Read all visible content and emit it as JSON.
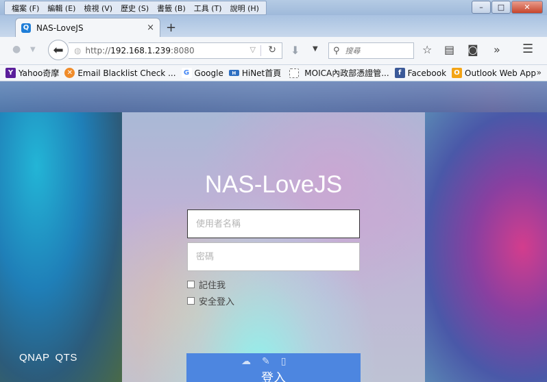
{
  "window": {
    "menu": [
      "檔案 (F)",
      "編輯 (E)",
      "檢視 (V)",
      "歷史 (S)",
      "書籤 (B)",
      "工具 (T)",
      "說明 (H)"
    ],
    "controls": {
      "minimize": "–",
      "maximize": "□",
      "close": "✕"
    }
  },
  "tab": {
    "favicon": "Q",
    "title": "NAS-LoveJS",
    "close": "×",
    "new_tab": "+"
  },
  "navbar": {
    "url_scheme": "http://",
    "url_host": "192.168.1.239",
    "url_port": ":8080",
    "search_placeholder": "搜尋"
  },
  "bookmarks": {
    "items": [
      {
        "label": "Yahoo奇摩",
        "icon": "Y",
        "color": "#5b1f9b"
      },
      {
        "label": "Email Blacklist Check ...",
        "icon": "✕",
        "color": "#f08c2a"
      },
      {
        "label": "Google",
        "icon": "G",
        "color": "#ffffff"
      },
      {
        "label": "HiNet首頁",
        "icon": "H",
        "color": "#2e6fc1"
      },
      {
        "label": "MOICA內政部憑證管...",
        "icon": "",
        "color": "#ffffff"
      },
      {
        "label": "Facebook",
        "icon": "f",
        "color": "#3b5998"
      },
      {
        "label": "Outlook Web App",
        "icon": "O",
        "color": "#f3a416"
      }
    ],
    "more": "»"
  },
  "login": {
    "title": "NAS-LoveJS",
    "username_placeholder": "使用者名稱",
    "password_placeholder": "密碼",
    "remember_me": "記住我",
    "secure_login": "安全登入",
    "submit": "登入"
  },
  "footer": {
    "brand": "QNAP",
    "product": "QTS"
  },
  "colors": {
    "login_button": "#4d86e0",
    "accent": "#1f7ed8"
  }
}
